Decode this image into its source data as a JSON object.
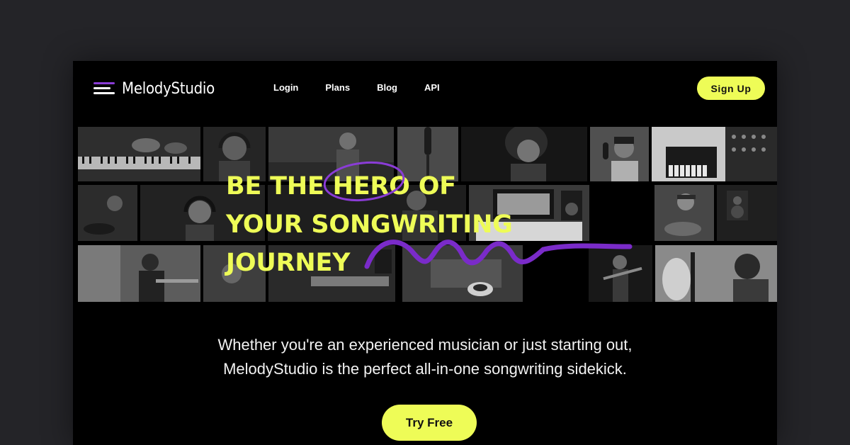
{
  "brand": {
    "name": "MelodyStudio",
    "accent": "#8a3cd6",
    "highlight": "#eefc57"
  },
  "nav": {
    "links": [
      {
        "label": "Login"
      },
      {
        "label": "Plans"
      },
      {
        "label": "Blog"
      },
      {
        "label": "API"
      }
    ],
    "signup_label": "Sign Up"
  },
  "hero": {
    "headline": [
      "BE THE HERO OF",
      "YOUR SONGWRITING",
      "JOURNEY"
    ],
    "emphasized_word": "HERO",
    "images": [
      "piano-keys-photo",
      "headphones-man-photo",
      "guitarist-photo",
      "studio-mic-photo",
      "singer-woman-photo",
      "mic-hat-photo",
      "midi-controller-photo",
      "mixing-desk-photo",
      "drummer-photo",
      "studio-headphones-photo",
      "producer-photo",
      "studio-monitors-photo",
      "woman-guitar-photo",
      "speaker-photo",
      "guitar-player-photo",
      "recording-photo",
      "keyboard-photo",
      "coffee-photo",
      "violinist-photo",
      "woman-mic-photo"
    ]
  },
  "tagline": [
    "Whether you're an experienced musician or just starting out,",
    "MelodyStudio is the perfect all-in-one songwriting sidekick."
  ],
  "cta_label": "Try Free"
}
